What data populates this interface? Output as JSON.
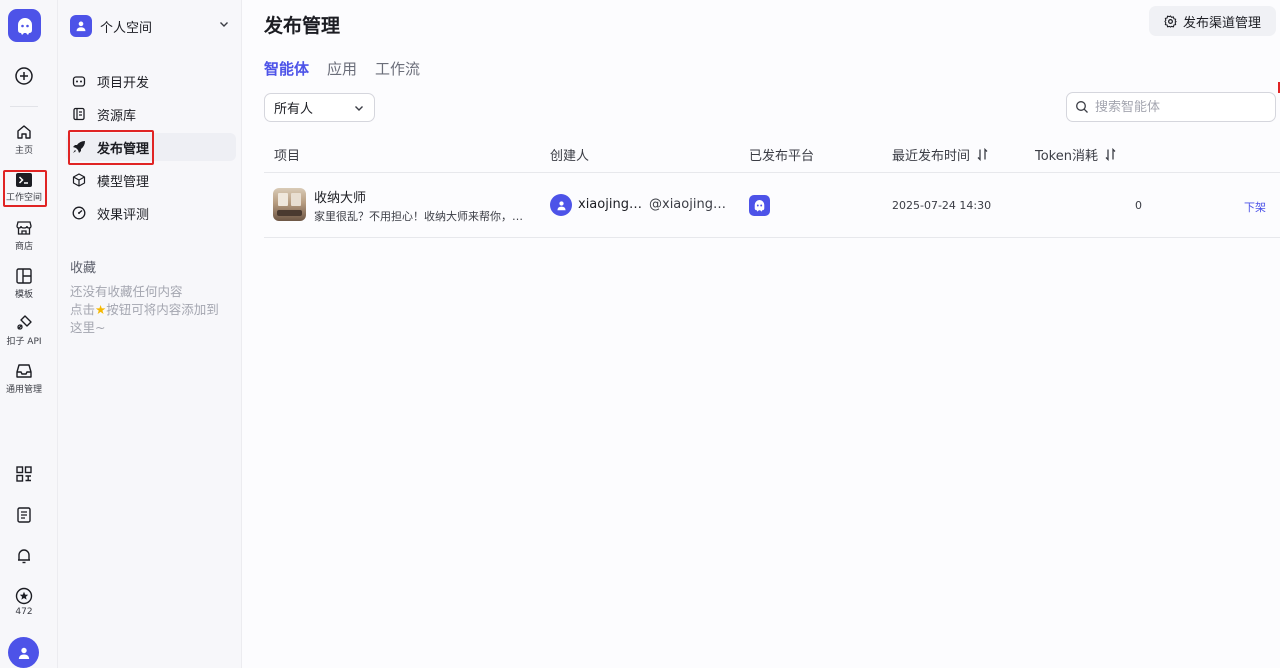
{
  "rail": {
    "items": [
      {
        "label": "主页"
      },
      {
        "label": "工作空间"
      },
      {
        "label": "商店"
      },
      {
        "label": "模板"
      },
      {
        "label": "扣子 API"
      },
      {
        "label": "通用管理"
      }
    ],
    "favorites_count": "472"
  },
  "sidebar": {
    "space_name": "个人空间",
    "nav": [
      {
        "label": "项目开发"
      },
      {
        "label": "资源库"
      },
      {
        "label": "发布管理"
      },
      {
        "label": "模型管理"
      },
      {
        "label": "效果评测"
      }
    ],
    "favorites_title": "收藏",
    "favorites_empty_line1": "还没有收藏任何内容",
    "favorites_empty_line2_prefix": "点击",
    "favorites_empty_line2_suffix": "按钮可将内容添加到",
    "favorites_empty_line3": "这里~"
  },
  "main": {
    "title": "发布管理",
    "channel_button": "发布渠道管理",
    "tabs": [
      {
        "label": "智能体",
        "active": true
      },
      {
        "label": "应用",
        "active": false
      },
      {
        "label": "工作流",
        "active": false
      }
    ],
    "owner_filter": "所有人",
    "search_placeholder": "搜索智能体",
    "columns": {
      "project": "项目",
      "creator": "创建人",
      "platform": "已发布平台",
      "last_publish": "最近发布时间",
      "token": "Token消耗"
    },
    "rows": [
      {
        "name": "收纳大师",
        "description": "家里很乱？不用担心！收纳大师来帮你，为你提供专业的收纳建议",
        "creator_name": "xiaojingxiaojing",
        "creator_handle": "@xiaojingaxiaojing",
        "publish_time": "2025-07-24 14:30",
        "token": "0",
        "action": "下架"
      }
    ]
  },
  "colors": {
    "brand": "#4d53e8",
    "highlight_outline": "#e02424"
  }
}
